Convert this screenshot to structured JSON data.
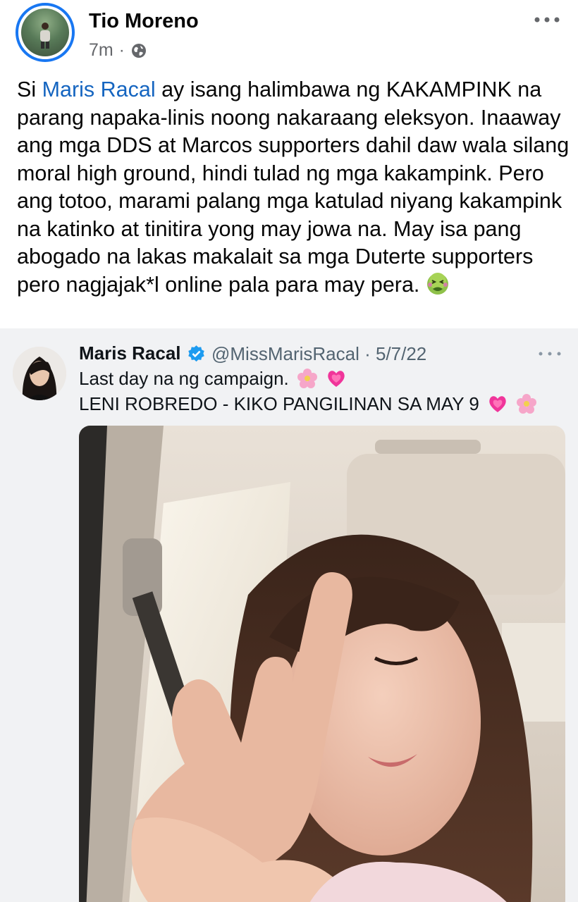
{
  "post": {
    "author_name": "Tio Moreno",
    "time": "7m",
    "separator": "·",
    "audience_icon": "globe-icon",
    "more_icon": "more-horizontal-icon",
    "text_before_mention": "Si ",
    "mention": "Maris Racal",
    "text_after_mention": " ay isang halimbawa ng KAKAMPINK na parang napaka-linis noong nakaraang eleksyon. Inaaway ang mga DDS at Marcos supporters dahil daw wala silang moral high ground, hindi tulad ng mga kakampink. Pero ang totoo, marami palang mga katulad niyang kakampink na katinko at tinitira yong may jowa na. May isa pang abogado na lakas makalait sa mga Duterte supporters pero nagjajak*l online pala para may pera. ",
    "end_emoji": "nauseated-face-icon"
  },
  "tweet": {
    "name": "Maris Racal",
    "verified_icon": "verified-badge-icon",
    "handle_date": "@MissMarisRacal · 5/7/22",
    "more_icon": "more-horizontal-icon",
    "line1": "Last day na ng campaign.",
    "line2": "LENI ROBREDO - KIKO PANGILINAN SA MAY 9",
    "emojis": [
      "cherry-blossom-icon",
      "growing-heart-icon"
    ]
  },
  "colors": {
    "mention": "#1565c0",
    "verified": "#1d9bf0",
    "avatar_ring": "#1877f2",
    "card_bg": "#f1f2f4",
    "secondary_text": "#65676b"
  }
}
